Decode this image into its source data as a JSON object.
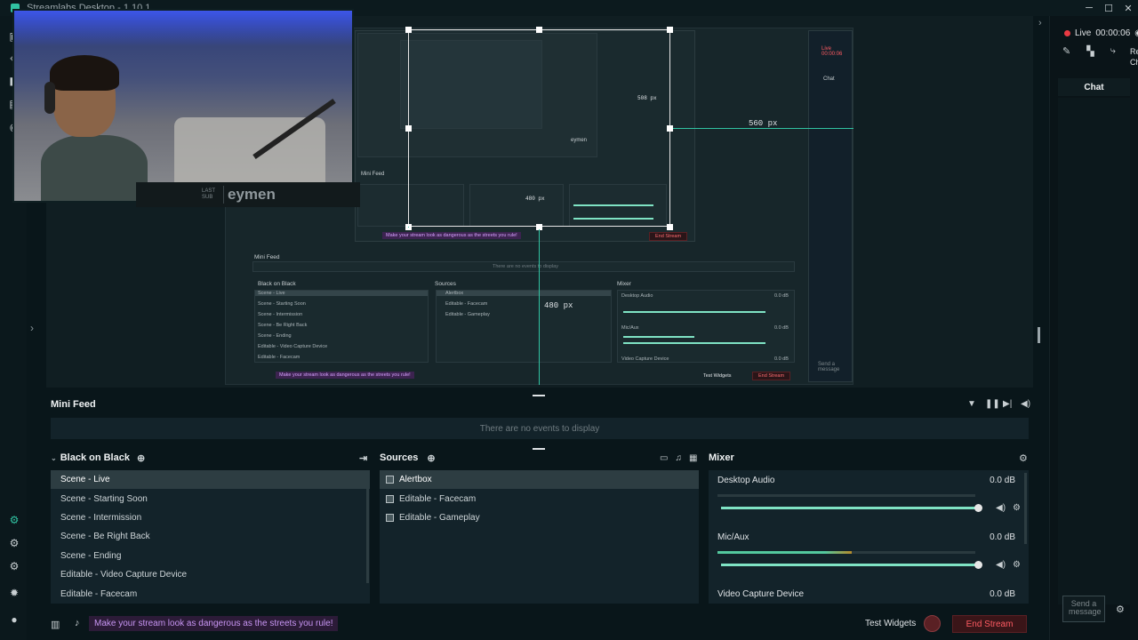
{
  "app": {
    "title": "Streamlabs Desktop - 1.10.1"
  },
  "window_controls": {
    "minimize": "─",
    "maximize": "☐",
    "close": "✕"
  },
  "webcam": {
    "last_sub_label_1": "LAST",
    "last_sub_label_2": "SUB",
    "last_sub_name": "eymen"
  },
  "editor": {
    "guide_label_1": "560 px",
    "guide_label_2": "480 px",
    "guide_label_small_1": "508 px",
    "guide_label_small_2": "480 px"
  },
  "nested": {
    "mini_feed": "Mini Feed",
    "no_events": "There are no events to display",
    "scene_collection": "Black on Black",
    "sources": "Sources",
    "mixer": "Mixer",
    "scenes": [
      "Scene - Live",
      "Scene - Starting Soon",
      "Scene - Intermission",
      "Scene - Be Right Back",
      "Scene - Ending",
      "Editable - Video Capture Device",
      "Editable - Facecam"
    ],
    "source_items": [
      "Alertbox",
      "Editable - Facecam",
      "Editable - Gameplay"
    ],
    "desktop_audio": "Desktop Audio",
    "mic_aux": "Mic/Aux",
    "video_capture": "Video Capture Device",
    "db": "0.0 dB",
    "promo": "Make your stream look as dangerous as the streets you rule!",
    "test_widgets": "Test Widgets",
    "end_stream": "End Stream",
    "chat": "Chat",
    "live": "Live 00:00:06",
    "send": "Send a message",
    "inner_name": "eymen"
  },
  "mini_feed": {
    "title": "Mini Feed",
    "empty": "There are no events to display"
  },
  "scenes_panel": {
    "title": "Black on Black",
    "items": [
      {
        "label": "Scene - Live"
      },
      {
        "label": "Scene - Starting Soon"
      },
      {
        "label": "Scene - Intermission"
      },
      {
        "label": "Scene - Be Right Back"
      },
      {
        "label": "Scene - Ending"
      },
      {
        "label": "Editable - Video Capture Device"
      },
      {
        "label": "Editable - Facecam"
      }
    ]
  },
  "sources_panel": {
    "title": "Sources",
    "items": [
      {
        "label": "Alertbox"
      },
      {
        "label": "Editable - Facecam"
      },
      {
        "label": "Editable - Gameplay"
      }
    ]
  },
  "mixer_panel": {
    "title": "Mixer",
    "items": [
      {
        "name": "Desktop Audio",
        "db": "0.0 dB",
        "level": 0.0,
        "volume": 1.0
      },
      {
        "name": "Mic/Aux",
        "db": "0.0 dB",
        "level": 0.52,
        "volume": 1.0
      },
      {
        "name": "Video Capture Device",
        "db": "0.0 dB"
      }
    ]
  },
  "footer": {
    "promo": "Make your stream look as dangerous as the streets you rule!",
    "test_widgets": "Test Widgets",
    "end_stream": "End Stream"
  },
  "right_panel": {
    "live": "Live",
    "timer": "00:00:06",
    "chat_tab": "Chat",
    "send_placeholder": "Send a message",
    "truncated_1": "Re",
    "truncated_2": "Ch"
  },
  "colors": {
    "accent": "#31c3a2",
    "danger": "#ff5b62",
    "promo": "#c795f2",
    "live_dot": "#ea3a43"
  }
}
